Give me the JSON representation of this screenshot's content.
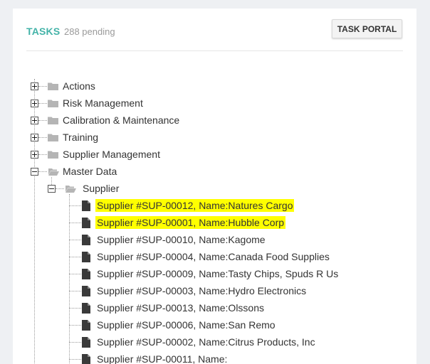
{
  "header": {
    "title": "TASKS",
    "pending": "288 pending",
    "portal_button": "TASK PORTAL"
  },
  "tree": {
    "folders": [
      {
        "label": "Actions",
        "expanded": false
      },
      {
        "label": "Risk Management",
        "expanded": false
      },
      {
        "label": "Calibration & Maintenance",
        "expanded": false
      },
      {
        "label": "Training",
        "expanded": false
      },
      {
        "label": "Supplier Management",
        "expanded": false
      },
      {
        "label": "Master Data",
        "expanded": true
      }
    ],
    "subfolder": {
      "label": "Supplier",
      "expanded": true
    },
    "suppliers": [
      {
        "label": "Supplier #SUP-00012, Name:Natures Cargo",
        "highlighted": true
      },
      {
        "label": "Supplier #SUP-00001, Name:Hubble Corp",
        "highlighted": true
      },
      {
        "label": "Supplier #SUP-00010, Name:Kagome",
        "highlighted": false
      },
      {
        "label": "Supplier #SUP-00004, Name:Canada Food Supplies",
        "highlighted": false
      },
      {
        "label": "Supplier #SUP-00009, Name:Tasty Chips, Spuds R Us",
        "highlighted": false
      },
      {
        "label": "Supplier #SUP-00003, Name:Hydro Electronics",
        "highlighted": false
      },
      {
        "label": "Supplier #SUP-00013, Name:Olssons",
        "highlighted": false
      },
      {
        "label": "Supplier #SUP-00006, Name:San Remo",
        "highlighted": false
      },
      {
        "label": "Supplier #SUP-00002, Name:Citrus Products, Inc",
        "highlighted": false
      },
      {
        "label": "Supplier #SUP-00011, Name:",
        "highlighted": false
      }
    ]
  },
  "colors": {
    "accent": "#43b3a8",
    "highlight": "#ffff00",
    "folder": "#b5b5b5",
    "file": "#3a3a3a"
  },
  "icons": {
    "folder": "folder-icon",
    "folder_open": "folder-open-icon",
    "file": "file-icon",
    "expand": "plus-box-icon",
    "collapse": "minus-box-icon"
  }
}
